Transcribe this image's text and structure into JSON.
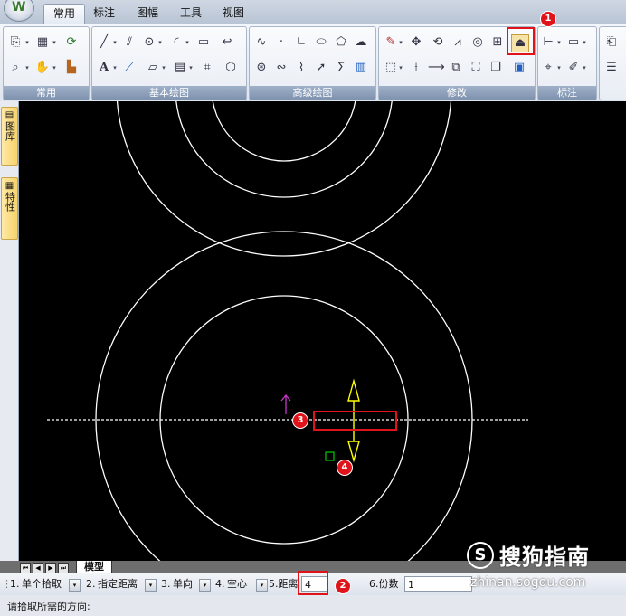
{
  "tabs": [
    "常用",
    "标注",
    "图幅",
    "工具",
    "视图"
  ],
  "app_logo_glyph": "W",
  "ribbon_groups": [
    "常用",
    "基本绘图",
    "高级绘图",
    "修改",
    "标注"
  ],
  "ribbon_icons": {
    "common": [
      "clipboard-copy-icon",
      "paste-icon",
      "match-properties-icon",
      "zoom-icon",
      "pan-icon",
      "brush-icon"
    ],
    "draw": [
      "line-icon",
      "parallel-line-icon",
      "circle-icon",
      "arc-icon",
      "rectangle-icon",
      "polyline-icon",
      "text-icon",
      "slash-icon",
      "hatch-icon",
      "table-icon",
      "block-icon",
      "region-icon"
    ],
    "advanced": [
      "spline-icon",
      "point-icon",
      "angle-icon",
      "ellipse-icon",
      "polygon-icon",
      "wave-icon",
      "pattern-icon",
      "curve-icon",
      "break-icon",
      "arrow-icon",
      "revision-cloud-icon",
      "insert-icon"
    ],
    "modify": [
      "erase-icon",
      "move-icon",
      "rotate-icon",
      "mirror-icon",
      "offset-icon",
      "array-icon",
      "equidistant-line-icon",
      "box-select-icon",
      "trim-icon",
      "extend-icon",
      "scale-icon",
      "stretch-icon",
      "copy-icon",
      "explode-icon"
    ],
    "annotate": [
      "dimension-icon",
      "text-style-icon",
      "tolerance-icon",
      "leader-icon"
    ]
  },
  "left_tabs": [
    "图库",
    "特性"
  ],
  "layout_tab": "模型",
  "nav_buttons": [
    "⏮",
    "◀",
    "▶",
    "⏭"
  ],
  "options": {
    "opt1_num": "1.",
    "opt1_value": "单个拾取",
    "opt2_num": "2.",
    "opt2_value": "指定距离",
    "opt3_num": "3.",
    "opt3_value": "单向",
    "opt4_num": "4.",
    "opt4_value": "空心",
    "opt5_label": "5.距离",
    "opt5_value": "4",
    "opt6_label": "6.份数",
    "opt6_value": "1"
  },
  "status_prompt": "请拾取所需的方向:",
  "markers": [
    "1",
    "2",
    "3",
    "4"
  ],
  "watermark": {
    "name": "搜狗指南",
    "url": "zhinan.sogou.com",
    "logo_glyph": "S"
  },
  "colors": {
    "canvas": "#000000",
    "entity": "#ffffff",
    "direction_arrow": "#ffff00",
    "cursor": "#cc33cc",
    "pick_box": "#00cc00",
    "highlight": "#e0131a"
  }
}
